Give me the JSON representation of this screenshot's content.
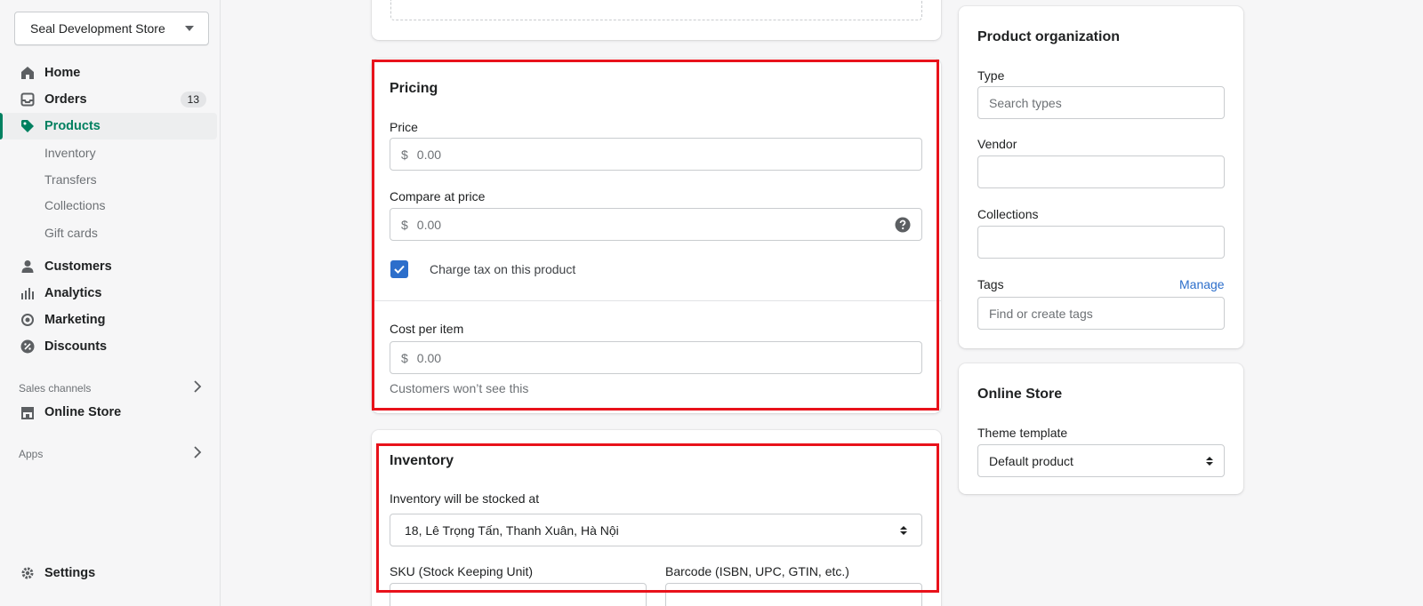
{
  "sidebar": {
    "store_name": "Seal Development Store",
    "nav": {
      "home": "Home",
      "orders": "Orders",
      "orders_badge": "13",
      "products": "Products",
      "inventory": "Inventory",
      "transfers": "Transfers",
      "collections": "Collections",
      "gift_cards": "Gift cards",
      "customers": "Customers",
      "analytics": "Analytics",
      "marketing": "Marketing",
      "discounts": "Discounts",
      "sales_channels": "Sales channels",
      "online_store": "Online Store",
      "apps": "Apps",
      "settings": "Settings"
    },
    "active_color": "#008060"
  },
  "pricing": {
    "title": "Pricing",
    "price_label": "Price",
    "price_prefix": "$",
    "price_placeholder": "0.00",
    "compare_label": "Compare at price",
    "compare_prefix": "$",
    "compare_placeholder": "0.00",
    "charge_tax_label": "Charge tax on this product",
    "charge_tax_checked": true,
    "cost_label": "Cost per item",
    "cost_prefix": "$",
    "cost_placeholder": "0.00",
    "cost_help": "Customers won’t see this"
  },
  "inventory": {
    "title": "Inventory",
    "stocked_label": "Inventory will be stocked at",
    "location_value": "18, Lê Trọng Tấn, Thanh Xuân, Hà Nội",
    "sku_label": "SKU (Stock Keeping Unit)",
    "barcode_label": "Barcode (ISBN, UPC, GTIN, etc.)"
  },
  "organization": {
    "title": "Product organization",
    "type_label": "Type",
    "type_placeholder": "Search types",
    "vendor_label": "Vendor",
    "collections_label": "Collections",
    "tags_label": "Tags",
    "tags_manage": "Manage",
    "tags_placeholder": "Find or create tags"
  },
  "online_store": {
    "title": "Online Store",
    "theme_label": "Theme template",
    "theme_value": "Default product"
  },
  "colors": {
    "highlight": "#e8121b",
    "link": "#2c6ecb",
    "checkbox": "#2c6ecb"
  }
}
